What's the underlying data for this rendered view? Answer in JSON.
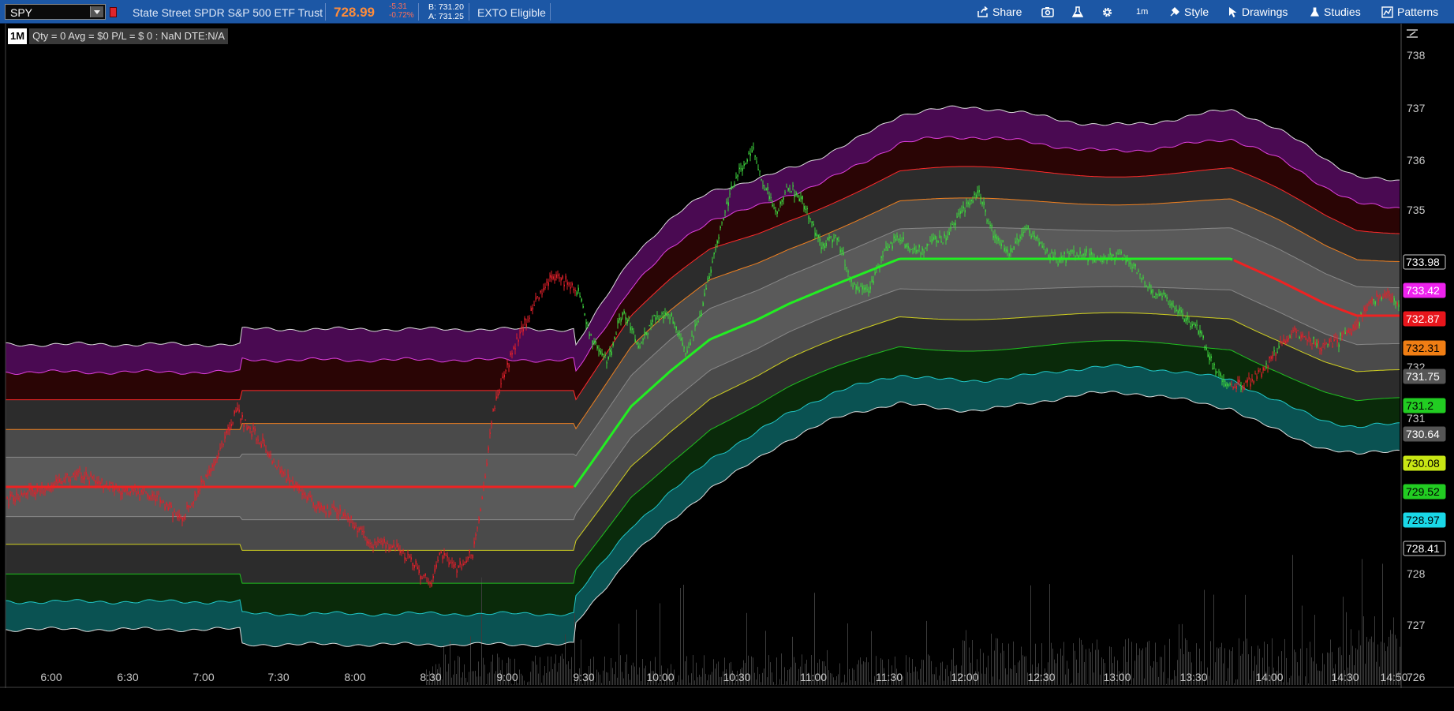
{
  "toolbar": {
    "symbol": "SPY",
    "description": "State Street SPDR S&P 500 ETF Trust",
    "last_price": "728.99",
    "net_change": "-5.31",
    "pct_change": "-0.72%",
    "bid": "B: 731.20",
    "ask": "A: 731.25",
    "exto": "EXTO Eligible",
    "share_label": "Share",
    "style_label": "Style",
    "drawings_label": "Drawings",
    "studies_label": "Studies",
    "patterns_label": "Patterns",
    "timeframe_label": "1m"
  },
  "badges": {
    "timeframe": "1M",
    "position": "Qty = 0  Avg = $0  P/L = $ 0  : NaN  DTE:N/A"
  },
  "colors": {
    "toolbar_bg": "#1c57a5",
    "up_candle": "#3dd13d",
    "down_candle": "#e0202a",
    "vwap_up": "#22ee22",
    "vwap_down": "#ee2222",
    "band_purple": "#4a0a52",
    "band_maroon": "#2a0505",
    "band_grey": "#2c2c2c",
    "band_grey2": "#4a4a4a",
    "band_green": "#0a2a0a",
    "band_teal": "#0a5252"
  },
  "axis": {
    "x_ticks": [
      "6:00",
      "6:30",
      "7:00",
      "7:30",
      "8:00",
      "8:30",
      "9:00",
      "9:30",
      "10:00",
      "10:30",
      "11:00",
      "11:30",
      "12:00",
      "12:30",
      "13:00",
      "13:30",
      "14:00",
      "14:30",
      "14:50"
    ],
    "y_ticks": [
      "738",
      "737",
      "736",
      "735",
      "732",
      "731",
      "728",
      "727",
      "726"
    ],
    "y_range": [
      725.8,
      738.3
    ]
  },
  "price_tags": [
    {
      "value": "733.98",
      "bg": "#000000",
      "fg": "#ffffff",
      "border": "#cccccc"
    },
    {
      "value": "733.42",
      "bg": "#ee22ee",
      "fg": "#ffffff",
      "border": "#ee22ee"
    },
    {
      "value": "732.87",
      "bg": "#e8161c",
      "fg": "#ffffff",
      "border": "#e8161c"
    },
    {
      "value": "732.31",
      "bg": "#f07e14",
      "fg": "#000000",
      "border": "#f07e14"
    },
    {
      "value": "731.75",
      "bg": "#555555",
      "fg": "#ffffff",
      "border": "#555555"
    },
    {
      "value": "731.2",
      "bg": "#22cc22",
      "fg": "#000000",
      "border": "#22cc22"
    },
    {
      "value": "730.64",
      "bg": "#555555",
      "fg": "#ffffff",
      "border": "#555555"
    },
    {
      "value": "730.08",
      "bg": "#c8e614",
      "fg": "#000000",
      "border": "#c8e614"
    },
    {
      "value": "729.52",
      "bg": "#22cc22",
      "fg": "#000000",
      "border": "#22cc22"
    },
    {
      "value": "728.97",
      "bg": "#1ad8e8",
      "fg": "#000000",
      "border": "#1ad8e8"
    },
    {
      "value": "728.41",
      "bg": "#000000",
      "fg": "#ffffff",
      "border": "#cccccc"
    }
  ]
}
